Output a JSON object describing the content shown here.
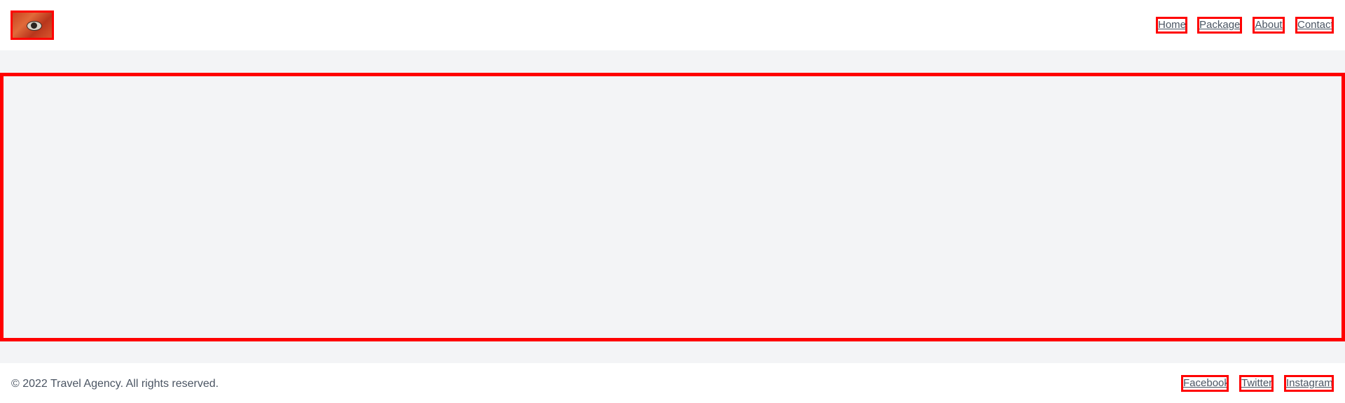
{
  "header": {
    "logo_icon": "eye-icon",
    "nav": [
      {
        "label": "Home"
      },
      {
        "label": "Packages"
      },
      {
        "label": "About"
      },
      {
        "label": "Contact"
      }
    ]
  },
  "footer": {
    "copyright": "© 2022 Travel Agency. All rights reserved.",
    "social": [
      {
        "label": "Facebook"
      },
      {
        "label": "Twitter"
      },
      {
        "label": "Instagram"
      }
    ]
  },
  "colors": {
    "highlight": "#ff0000",
    "text": "#4b5563",
    "page_bg": "#f3f4f6",
    "bar_bg": "#ffffff"
  }
}
